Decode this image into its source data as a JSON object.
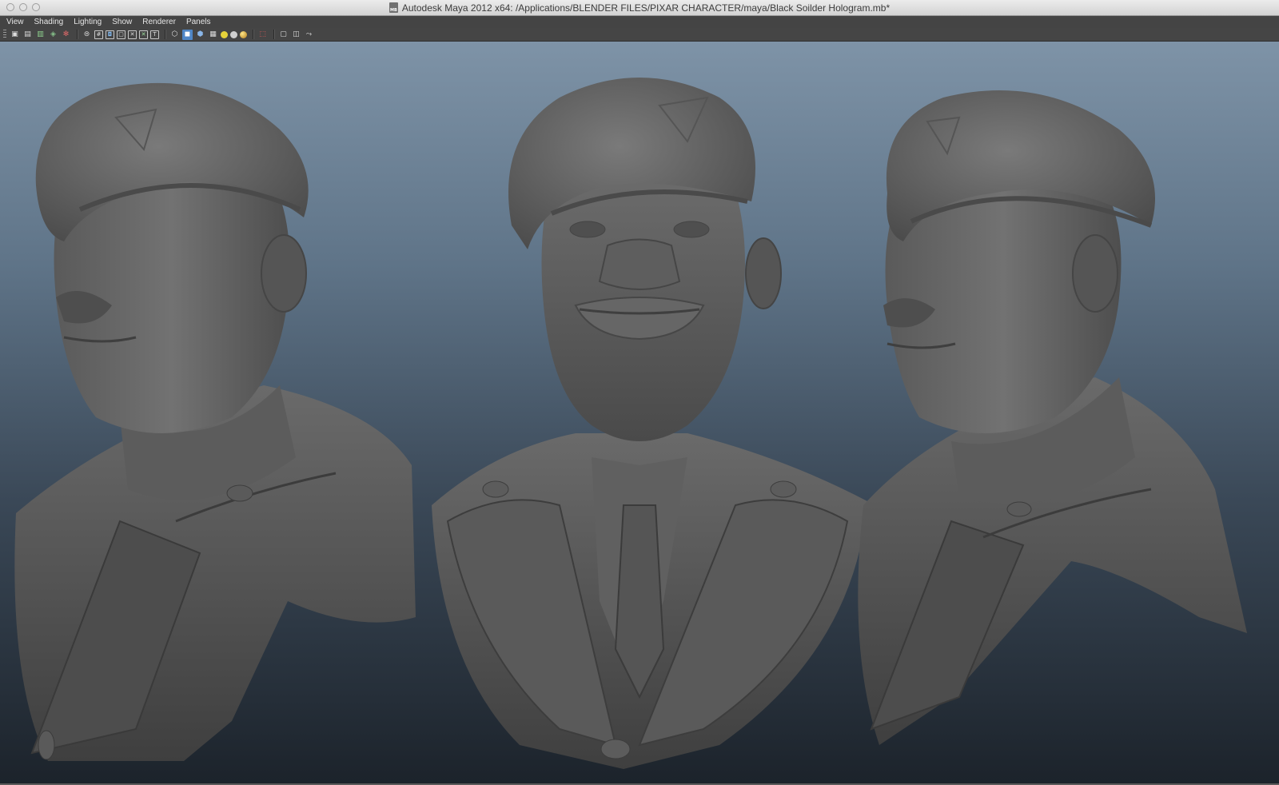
{
  "window": {
    "title": "Autodesk Maya 2012 x64: /Applications/BLENDER FILES/PIXAR CHARACTER/maya/Black Soilder Hologram.mb*",
    "doc_icon_label": "MB"
  },
  "menubar": {
    "items": [
      "View",
      "Shading",
      "Lighting",
      "Show",
      "Renderer",
      "Panels"
    ]
  },
  "toolbar": {
    "groups": [
      [
        "camera-icon",
        "camera-attributes-icon",
        "bookmark-icon",
        "image-plane-icon",
        "isolate-icon"
      ],
      [
        "wireframe-icon",
        "grid-icon",
        "film-gate-icon",
        "resolution-gate-icon",
        "field-chart-icon",
        "safe-action-icon",
        "safe-title-icon"
      ],
      [
        "wireframe-shade-icon",
        "smooth-shade-icon",
        "textured-icon",
        "checker-icon",
        "default-light-icon",
        "all-lights-icon",
        "shadows-icon"
      ],
      [
        "select-highlight-icon"
      ],
      [
        "single-pane-icon",
        "two-pane-icon",
        "share-icon"
      ]
    ]
  },
  "viewport": {
    "background_top": "#7e93a7",
    "background_bottom": "#1c232b",
    "model_color": "#6a6a6a",
    "views": [
      "left-three-quarter-view",
      "front-view",
      "right-three-quarter-view"
    ]
  }
}
